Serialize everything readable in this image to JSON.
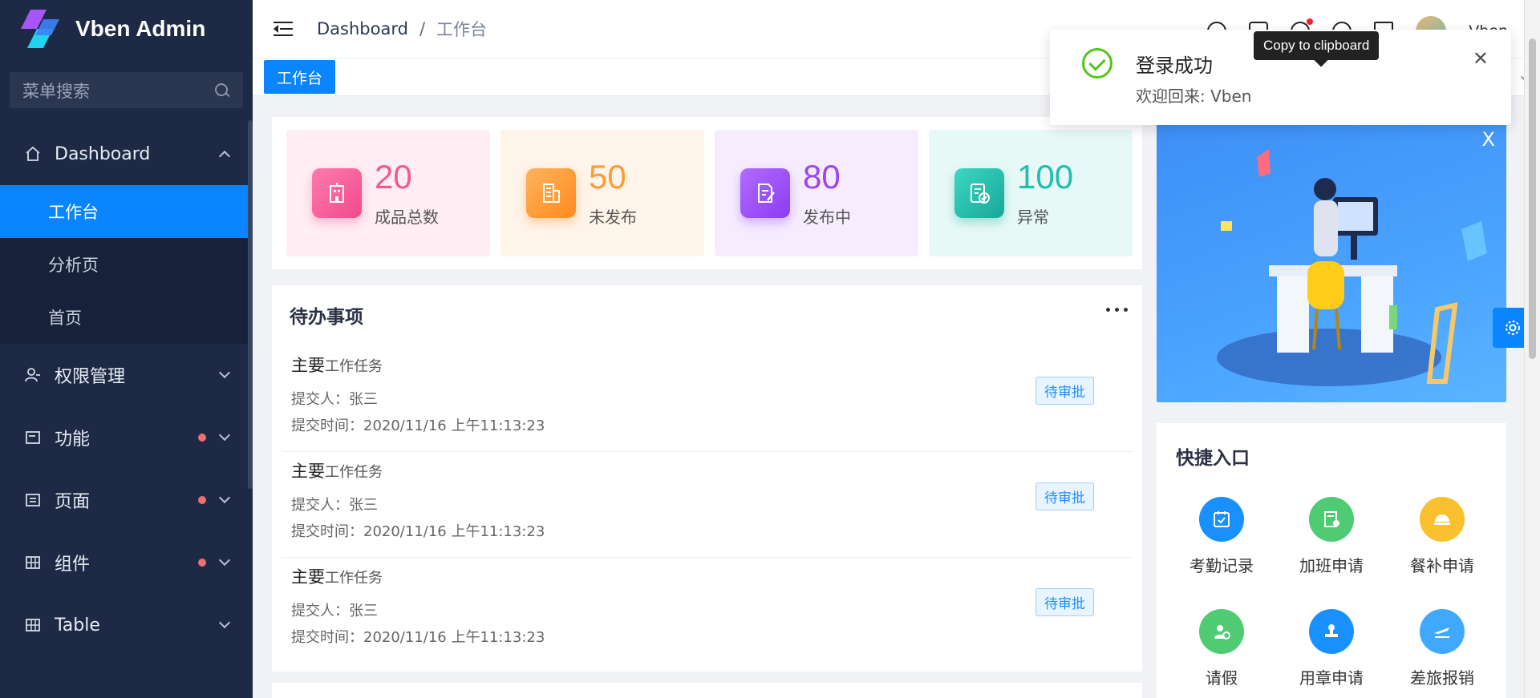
{
  "sidebar": {
    "title": "Vben Admin",
    "search_placeholder": "菜单搜索",
    "menu": [
      {
        "label": "Dashboard",
        "icon": "home-icon",
        "expanded": true,
        "children": [
          "工作台",
          "分析页",
          "首页"
        ],
        "active_child": "工作台"
      },
      {
        "label": "权限管理",
        "icon": "user-icon",
        "dot": false
      },
      {
        "label": "功能",
        "icon": "window-icon",
        "dot": true
      },
      {
        "label": "页面",
        "icon": "page-icon",
        "dot": true
      },
      {
        "label": "组件",
        "icon": "grid-icon",
        "dot": true
      },
      {
        "label": "Table",
        "icon": "table-icon",
        "dot": false
      }
    ]
  },
  "header": {
    "breadcrumb": [
      "Dashboard",
      "工作台"
    ],
    "breadcrumb_separator": "/",
    "user_name": "Vben"
  },
  "tabs": {
    "items": [
      "工作台"
    ],
    "active": "工作台"
  },
  "stats": [
    {
      "value": "20",
      "label": "成品总数",
      "color": "#f25a8f",
      "bg": "#ffeef3"
    },
    {
      "value": "50",
      "label": "未发布",
      "color": "#ff9b35",
      "bg": "#fff4ea"
    },
    {
      "value": "80",
      "label": "发布中",
      "color": "#9b46f0",
      "bg": "#f6ecff"
    },
    {
      "value": "100",
      "label": "异常",
      "color": "#1fbfad",
      "bg": "#e6f9f6"
    }
  ],
  "todo": {
    "title": "待办事项",
    "items": [
      {
        "title_main": "主要",
        "title_sub": "工作任务",
        "submitter": "提交人：张三",
        "time": "提交时间：2020/11/16 上午11:13:23",
        "status": "待审批"
      },
      {
        "title_main": "主要",
        "title_sub": "工作任务",
        "submitter": "提交人：张三",
        "time": "提交时间：2020/11/16 上午11:13:23",
        "status": "待审批"
      },
      {
        "title_main": "主要",
        "title_sub": "工作任务",
        "submitter": "提交人：张三",
        "time": "提交时间：2020/11/16 上午11:13:23",
        "status": "待审批"
      }
    ]
  },
  "banner": {
    "close_label": "X"
  },
  "quick": {
    "title": "快捷入口",
    "items": [
      {
        "label": "考勤记录",
        "color": "#1890ff",
        "icon": "calendar-check-icon"
      },
      {
        "label": "加班申请",
        "color": "#4ecb73",
        "icon": "document-icon"
      },
      {
        "label": "餐补申请",
        "color": "#fbc02d",
        "icon": "meal-icon"
      },
      {
        "label": "请假",
        "color": "#4ecb73",
        "icon": "leave-clock-icon"
      },
      {
        "label": "用章申请",
        "color": "#1890ff",
        "icon": "stamp-icon"
      },
      {
        "label": "差旅报销",
        "color": "#3fa9ff",
        "icon": "plane-icon"
      }
    ]
  },
  "notification": {
    "title": "登录成功",
    "description": "欢迎回来: Vben"
  },
  "tooltip": {
    "text": "Copy to clipboard"
  }
}
